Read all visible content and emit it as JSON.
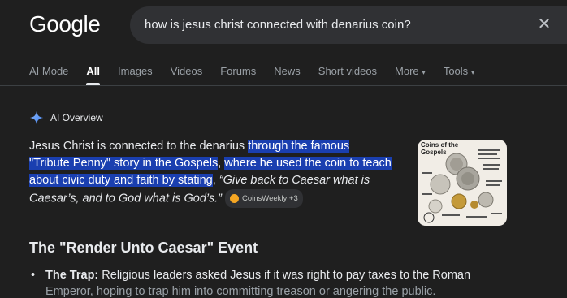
{
  "logo": "Google",
  "search": {
    "query": "how is jesus christ connected with denarius coin?"
  },
  "tabs": [
    "AI Mode",
    "All",
    "Images",
    "Videos",
    "Forums",
    "News",
    "Short videos",
    "More",
    "Tools"
  ],
  "ai_overview": {
    "label": "AI Overview",
    "text_plain_1": "Jesus Christ is connected to the denarius ",
    "text_hl_1": "through the famous",
    "text_hl_2": "\"Tribute Penny\" story in the Gospels",
    "text_plain_2": ", ",
    "text_hl_3": "where he used the coin to teach about civic duty and faith by stating",
    "text_plain_3": ", ",
    "quote": "“Give back to Caesar what is Caesar’s, and to God what is God’s.”",
    "source_chip": "CoinsWeekly +3"
  },
  "thumbnail": {
    "title": "Coins of the Gospels"
  },
  "section": {
    "title": "The \"Render Unto Caesar\" Event",
    "bullet_label": "The Trap:",
    "bullet_text": " Religious leaders asked Jesus if it was right to pay taxes to the Roman",
    "bullet_next": "Emperor, hoping to trap him into committing treason or angering the public."
  }
}
